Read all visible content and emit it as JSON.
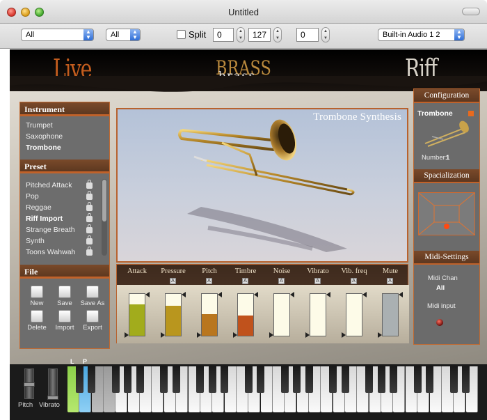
{
  "window": {
    "title": "Untitled"
  },
  "toolbar": {
    "filter1": "All",
    "filter2": "All",
    "split_label": "Split",
    "range_low": "0",
    "range_high": "127",
    "transpose": "0",
    "audio_device": "Built-in Audio 1 2"
  },
  "banner": {
    "live": "Live",
    "brass": "BRASS",
    "brass_sub": "brass",
    "riff": "Riff"
  },
  "instrument": {
    "title": "Instrument",
    "items": [
      "Trumpet",
      "Saxophone",
      "Trombone"
    ],
    "selected": "Trombone"
  },
  "preset": {
    "title": "Preset",
    "items": [
      "Pitched Attack",
      "Pop",
      "Reggae",
      "Riff Import",
      "Strange Breath",
      "Synth",
      "Toons Wahwah"
    ],
    "selected": "Riff Import"
  },
  "file": {
    "title": "File",
    "buttons": [
      "New",
      "Save",
      "Save As",
      "Delete",
      "Import",
      "Export"
    ]
  },
  "viewport": {
    "title": "Trombone Synthesis"
  },
  "controls": [
    {
      "label": "Attack",
      "level": 0.75,
      "color": "#a2ac1c",
      "auto": ""
    },
    {
      "label": "Pressure",
      "level": 0.72,
      "color": "#b9961e",
      "auto": "A"
    },
    {
      "label": "Pitch",
      "level": 0.52,
      "color": "#b9761e",
      "auto": "A"
    },
    {
      "label": "Timbre",
      "level": 0.48,
      "color": "#c0521c",
      "auto": "A"
    },
    {
      "label": "Noise",
      "level": 0.0,
      "color": "#c0521c",
      "auto": "A"
    },
    {
      "label": "Vibrato",
      "level": 0.0,
      "color": "#c0521c",
      "auto": "A"
    },
    {
      "label": "Vib. freq",
      "level": 0.0,
      "color": "#c0521c",
      "auto": "A"
    },
    {
      "label": "Mute",
      "level": 1.0,
      "color": "#aab0b2",
      "auto": "A"
    }
  ],
  "configuration": {
    "title": "Configuration",
    "instrument": "Trombone",
    "number_label": "Number:",
    "number": "1"
  },
  "spacialization": {
    "title": "Spacialization"
  },
  "midi": {
    "title": "Midi-Settings",
    "chan_label": "Midi Chan",
    "chan_value": "All",
    "input_label": "Midi input"
  },
  "keyboard": {
    "pitch_label": "Pitch",
    "vibrato_label": "Vibrato",
    "l_marker": "L",
    "p_marker": "P"
  }
}
